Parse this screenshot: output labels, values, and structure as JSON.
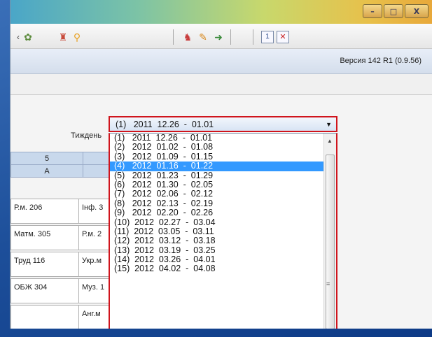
{
  "window": {
    "buttons": {
      "minimize": "–",
      "maximize": "□",
      "close": "X"
    }
  },
  "toolbar": {
    "icons": [
      "partial-icon",
      "puzzle-icon",
      "users-icon",
      "user-search-icon",
      "user-group-icon",
      "edit-icon",
      "exit-icon",
      "one-icon",
      "close-doc-icon"
    ]
  },
  "version": {
    "text": "Версия 142 R1 (0.9.56)"
  },
  "schedule": {
    "week_label": "Тиждень",
    "header_row1": [
      "5",
      ""
    ],
    "header_row2": [
      "А",
      ""
    ],
    "rows": [
      [
        "Р.м. 206",
        "Інф. 3"
      ],
      [
        "Матм. 305",
        "Р.м. 2"
      ],
      [
        "Труд 116",
        "Укр.м"
      ],
      [
        "ОБЖ 304",
        "Муз. 1"
      ],
      [
        "",
        "Анг.м"
      ]
    ]
  },
  "week_select": {
    "selected_value": "(1)   2011  12.26  -  01.01",
    "options": [
      "(1)   2011  12.26  -  01.01",
      "(2)   2012  01.02  -  01.08",
      "(3)   2012  01.09  -  01.15",
      "(4)   2012  01.16  -  01.22",
      "(5)   2012  01.23  -  01.29",
      "(6)   2012  01.30  -  02.05",
      "(7)   2012  02.06  -  02.12",
      "(8)   2012  02.13  -  02.19",
      "(9)   2012  02.20  -  02.26",
      "(10)  2012  02.27  -  03.04",
      "(11)  2012  03.05  -  03.11",
      "(12)  2012  03.12  -  03.18",
      "(13)  2012  03.19  -  03.25",
      "(14)  2012  03.26  -  04.01",
      "(15)  2012  04.02  -  04.08"
    ],
    "highlighted_index": 3
  },
  "colors": {
    "highlight": "#3399ff",
    "callout_border": "#d0141c"
  }
}
